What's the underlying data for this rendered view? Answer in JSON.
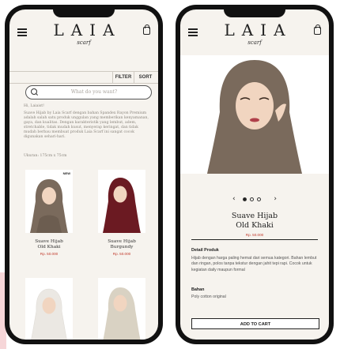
{
  "brand": {
    "name": "LAIA",
    "tagline": "scarf"
  },
  "catalog": {
    "filter_label": "FILTER",
    "sort_label": "SORT",
    "search_placeholder": "What do you want?",
    "greeting": "Hi, Laiaist!",
    "description": "Suave Hijab by Laia Scarf dengan bahan Spandex Rayon Premium adalah salah satu produk unggulan yang memberikan kenyamanan, gaya, dan kualitas. Dengan karakteristik yang lembut, adem, stretchable, tidak mudah kusut, menyerap keringat, dan tidak mudah berbau membuat produk Laia Scarf ini sangat cocok digunakan sehari-hari.",
    "size": "Ukuran: 175cm x 75cm",
    "products": [
      {
        "name_line1": "Suave Hijab",
        "name_line2": "Old Khaki",
        "price": "Rp. 50.000",
        "badge": "NEW",
        "scarf_color": "#7a6a5c"
      },
      {
        "name_line1": "Suave Hijab",
        "name_line2": "Burgundy",
        "price": "Rp. 50.000",
        "badge": "",
        "scarf_color": "#6b1a22"
      },
      {
        "name_line1": "",
        "name_line2": "",
        "price": "",
        "badge": "",
        "scarf_color": "#e9e6e1"
      },
      {
        "name_line1": "",
        "name_line2": "",
        "price": "",
        "badge": "",
        "scarf_color": "#d9d2c3"
      }
    ]
  },
  "detail": {
    "title_line1": "Suave Hijab",
    "title_line2": "Old Khaki",
    "price": "Rp. 50.000",
    "prev_arrow": "‹",
    "next_arrow": "›",
    "carousel_count": 3,
    "carousel_active_index": 0,
    "detail_label": "Detail Produk",
    "detail_text": "Hijab dengan harga paling hemat dari semua kategori. Bahan lembut dan ringan, polos tanpa tekstur dengan jahit tepi rapi. Cocok untuk kegiatan daily maupun formal",
    "material_label": "Bahan",
    "material_text": "Poly cotton original",
    "cart_label": "ADD TO CART",
    "scarf_color": "#7a6a5c"
  },
  "colors": {
    "background": "#f6f3ee",
    "price": "#c0392b",
    "accent_mark": "#f6d6d8"
  }
}
